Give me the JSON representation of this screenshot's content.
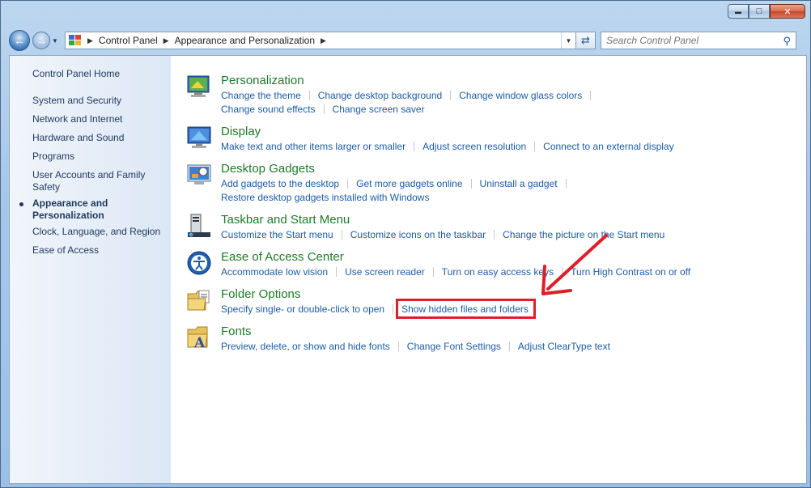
{
  "window": {
    "minimize": "▬",
    "maximize": "□",
    "close": "✕"
  },
  "nav": {
    "back_icon": "back-arrow-icon",
    "forward_icon": "forward-arrow-icon",
    "breadcrumb": [
      "Control Panel",
      "Appearance and Personalization"
    ],
    "search_placeholder": "Search Control Panel"
  },
  "sidebar": {
    "home": "Control Panel Home",
    "items": [
      {
        "label": "System and Security"
      },
      {
        "label": "Network and Internet"
      },
      {
        "label": "Hardware and Sound"
      },
      {
        "label": "Programs"
      },
      {
        "label": "User Accounts and Family Safety"
      },
      {
        "label": "Appearance and Personalization",
        "active": true
      },
      {
        "label": "Clock, Language, and Region"
      },
      {
        "label": "Ease of Access"
      }
    ]
  },
  "categories": [
    {
      "title": "Personalization",
      "icon": "personalization-icon",
      "lines": [
        [
          "Change the theme",
          "Change desktop background",
          "Change window glass colors"
        ],
        [
          "Change sound effects",
          "Change screen saver"
        ]
      ]
    },
    {
      "title": "Display",
      "icon": "display-icon",
      "lines": [
        [
          "Make text and other items larger or smaller",
          "Adjust screen resolution",
          "Connect to an external display"
        ]
      ]
    },
    {
      "title": "Desktop Gadgets",
      "icon": "desktop-gadgets-icon",
      "lines": [
        [
          "Add gadgets to the desktop",
          "Get more gadgets online",
          "Uninstall a gadget"
        ],
        [
          "Restore desktop gadgets installed with Windows"
        ]
      ]
    },
    {
      "title": "Taskbar and Start Menu",
      "icon": "taskbar-icon",
      "lines": [
        [
          "Customize the Start menu",
          "Customize icons on the taskbar",
          "Change the picture on the Start menu"
        ]
      ]
    },
    {
      "title": "Ease of Access Center",
      "icon": "ease-of-access-icon",
      "lines": [
        [
          "Accommodate low vision",
          "Use screen reader",
          "Turn on easy access keys",
          "Turn High Contrast on or off"
        ]
      ]
    },
    {
      "title": "Folder Options",
      "icon": "folder-options-icon",
      "lines": [
        [
          "Specify single- or double-click to open",
          "Show hidden files and folders"
        ]
      ]
    },
    {
      "title": "Fonts",
      "icon": "fonts-icon",
      "lines": [
        [
          "Preview, delete, or show and hide fonts",
          "Change Font Settings",
          "Adjust ClearType text"
        ]
      ]
    }
  ],
  "colors": {
    "link": "#1c5ca8",
    "category_title": "#1f7a27",
    "annotation": "#e01e2a"
  }
}
